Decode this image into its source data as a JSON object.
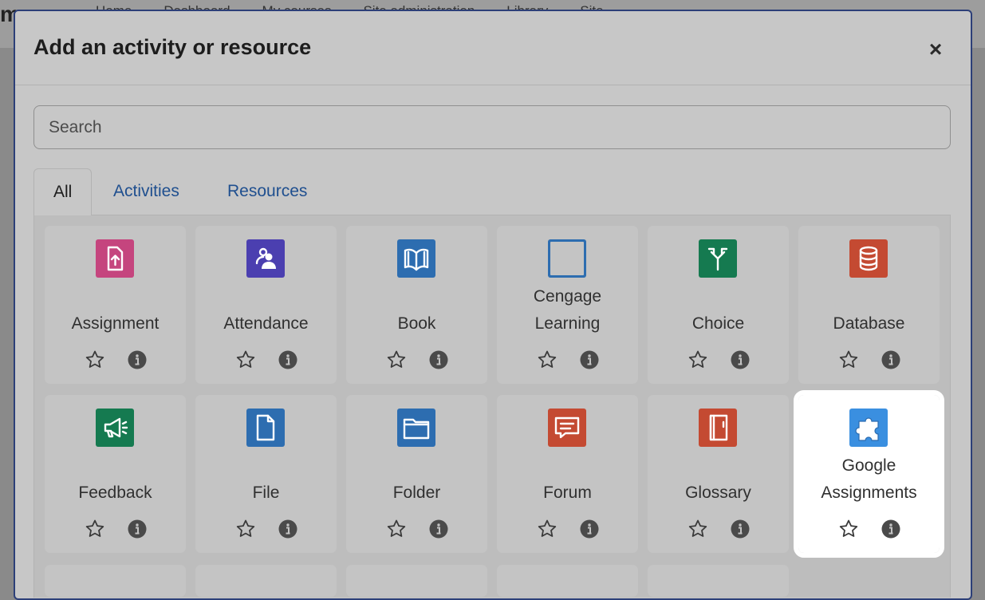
{
  "background": {
    "logo": "m",
    "nav": [
      "Home",
      "Dashboard",
      "My courses",
      "Site administration",
      "Library",
      "Site"
    ]
  },
  "modal": {
    "title": "Add an activity or resource",
    "close_label": "×",
    "search_placeholder": "Search",
    "tabs": [
      "All",
      "Activities",
      "Resources"
    ],
    "active_tab": "All"
  },
  "items": [
    {
      "lines": [
        "Assignment"
      ],
      "icon": "assignment-icon",
      "color": "#c5457e"
    },
    {
      "lines": [
        "Attendance"
      ],
      "icon": "attendance-icon",
      "color": "#4b3fb0"
    },
    {
      "lines": [
        "Book"
      ],
      "icon": "book-icon",
      "color": "#2d6db0"
    },
    {
      "lines": [
        "Cengage",
        "Learning"
      ],
      "icon": "cengage-icon",
      "color": "#2d6db0"
    },
    {
      "lines": [
        "Choice"
      ],
      "icon": "choice-icon",
      "color": "#157a50"
    },
    {
      "lines": [
        "Database"
      ],
      "icon": "database-icon",
      "color": "#c44a32"
    },
    {
      "lines": [
        "Feedback"
      ],
      "icon": "feedback-icon",
      "color": "#157a50"
    },
    {
      "lines": [
        "File"
      ],
      "icon": "file-icon",
      "color": "#2d6db0"
    },
    {
      "lines": [
        "Folder"
      ],
      "icon": "folder-icon",
      "color": "#2d6db0"
    },
    {
      "lines": [
        "Forum"
      ],
      "icon": "forum-icon",
      "color": "#c44a32"
    },
    {
      "lines": [
        "Glossary"
      ],
      "icon": "glossary-icon",
      "color": "#c44a32"
    },
    {
      "lines": [
        "Google",
        "Assignments"
      ],
      "icon": "puzzle-icon",
      "color": "#3a8fe0",
      "highlighted": true
    }
  ]
}
